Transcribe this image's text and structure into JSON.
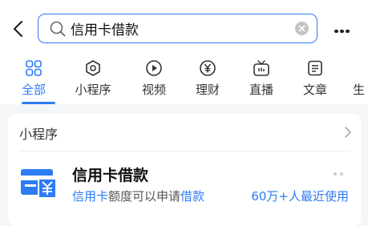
{
  "search": {
    "query": "信用卡借款"
  },
  "tabs": [
    {
      "label": "全部",
      "icon": "all-grid-icon",
      "active": true
    },
    {
      "label": "小程序",
      "icon": "mini-program-icon",
      "active": false
    },
    {
      "label": "视频",
      "icon": "video-play-icon",
      "active": false
    },
    {
      "label": "理财",
      "icon": "yuan-icon",
      "active": false
    },
    {
      "label": "直播",
      "icon": "tv-live-icon",
      "active": false
    },
    {
      "label": "文章",
      "icon": "article-icon",
      "active": false
    },
    {
      "label": "生",
      "icon": "",
      "active": false
    }
  ],
  "section": {
    "title": "小程序"
  },
  "result": {
    "name": "信用卡借款",
    "desc_prefix": "信用卡",
    "desc_middle": "额度可以申请",
    "desc_suffix": "借款",
    "users": "60万+人最近使用"
  },
  "colors": {
    "accent": "#2d7bf5",
    "background": "#f5f6f8"
  }
}
